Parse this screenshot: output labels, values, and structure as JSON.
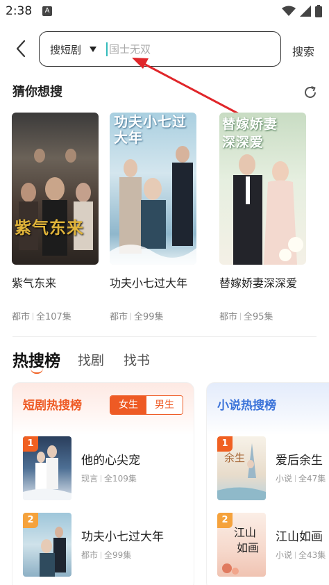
{
  "status_bar": {
    "time": "2:38",
    "badge": "A"
  },
  "search": {
    "type_label": "搜短剧",
    "placeholder": "国士无双",
    "button_label": "搜索"
  },
  "guess": {
    "title": "猜你想搜",
    "items": [
      {
        "name": "紫气东来",
        "cover_text": "紫气东来",
        "genre": "都市",
        "episodes": "全107集"
      },
      {
        "name": "功夫小七过大年",
        "cover_text": "功夫小七过大年",
        "genre": "都市",
        "episodes": "全99集"
      },
      {
        "name": "替嫁娇妻深深爱",
        "cover_text": "替嫁娇妻深深爱",
        "genre": "都市",
        "episodes": "全95集"
      }
    ]
  },
  "tabs": [
    "热搜榜",
    "找剧",
    "找书"
  ],
  "drama_rank": {
    "title": "短剧热搜榜",
    "toggle": [
      "女生",
      "男生"
    ],
    "items": [
      {
        "rank": "1",
        "name": "他的心尖宠",
        "genre": "现言",
        "episodes": "全109集"
      },
      {
        "rank": "2",
        "name": "功夫小七过大年",
        "genre": "都市",
        "episodes": "全99集"
      }
    ]
  },
  "novel_rank": {
    "title": "小说热搜榜",
    "items": [
      {
        "rank": "1",
        "name": "爱后余生",
        "genre": "小说",
        "episodes": "全47集"
      },
      {
        "rank": "2",
        "name": "江山如画",
        "genre": "小说",
        "episodes": "全43集"
      }
    ]
  },
  "colors": {
    "accent": "#ee5a24",
    "novel_accent": "#3b73d9",
    "annotation_arrow": "#e0262a"
  }
}
